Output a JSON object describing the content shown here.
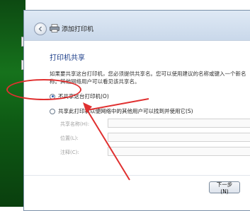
{
  "window": {
    "title": "添加打印机"
  },
  "page": {
    "heading": "打印机共享",
    "description": "如果要共享这台打印机，您必须提供共享名。您可以使用建议的名称或键入一个新名称。其他网络用户可以看见该共享名。"
  },
  "options": {
    "no_share_label": "不共享这台打印机(O)",
    "share_label": "共享此打印机以便网络中的其他用户可以找到并使用它(S)"
  },
  "fields": {
    "share_name_label": "共享名称(H):",
    "location_label": "位置(L):",
    "comment_label": "注释(C):"
  },
  "buttons": {
    "next_label": "下一步(N)"
  },
  "colors": {
    "annotation": "#e03030",
    "heading": "#1e3f8a"
  }
}
